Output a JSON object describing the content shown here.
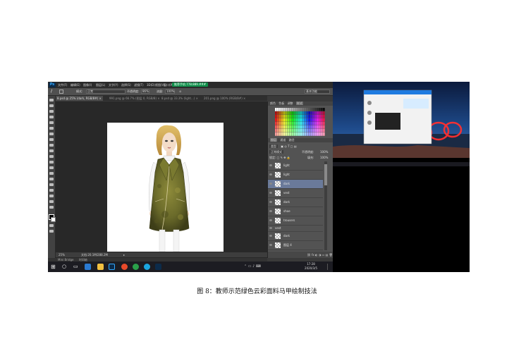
{
  "photoshop": {
    "logo": "Ps",
    "menu": [
      "文件(F)",
      "编辑(E)",
      "图像(I)",
      "图层(L)",
      "文字(Y)",
      "选择(S)",
      "滤镜(T)",
      "3D(D)",
      "视图(V)",
      "窗口(W)",
      "帮助(H)"
    ],
    "phone_badge": "推荐手机 778.889.###",
    "options": {
      "mode_label": "模式:",
      "mode_value": "正常",
      "opacity_label": "不透明度:",
      "opacity_value": "86%",
      "flow_label": "流量:",
      "flow_value": "100%",
      "workspace": "基本功能"
    },
    "tabs": [
      {
        "label": "8.psd @ 25% (dark, RGB/8#) ×",
        "active": true
      },
      {
        "label": "991.png @ 66.7% (图层 0, RGB/8) ×",
        "active": false
      },
      {
        "label": "8.psd @ 33.3% (light...) ×",
        "active": false
      },
      {
        "label": "201.png @ 100% (RGB/8#) ×",
        "active": false
      }
    ],
    "status": {
      "zoom": "25%",
      "doc": "文档:20.1M/288.2M"
    },
    "panels": {
      "swatches_tabs": [
        "颜色",
        "色板",
        "调整",
        "样式"
      ],
      "layers_tabs": [
        "图层",
        "通道",
        "路径"
      ],
      "layer_kind": "类型",
      "blend_mode": "正常模式",
      "opacity_label": "不透明度:",
      "opacity_value": "100%",
      "fill_label": "填充:",
      "fill_value": "100%",
      "layers": [
        {
          "name": "light",
          "selected": false
        },
        {
          "name": "light",
          "selected": false
        },
        {
          "name": "dark",
          "selected": true
        },
        {
          "name": "vest",
          "selected": false
        },
        {
          "name": "dark",
          "selected": false
        },
        {
          "name": "shoe",
          "selected": false
        },
        {
          "name": "trousers",
          "selected": false
        },
        {
          "name": "vest",
          "selected": false
        },
        {
          "name": "dark",
          "selected": false
        },
        {
          "name": "图层 4",
          "selected": false
        }
      ]
    },
    "minibridge": "Mini Bridge",
    "timeline": "时间轴"
  },
  "taskbar": {
    "time": "17:28",
    "date": "2020/3/5",
    "icons": [
      "start",
      "search",
      "task-view",
      "edge",
      "file-explorer",
      "photoshop",
      "browser",
      "360",
      "qq",
      "photoshop-2"
    ]
  },
  "caption": "图 8：教师示范绿色云彩面料马甲绘制技法"
}
